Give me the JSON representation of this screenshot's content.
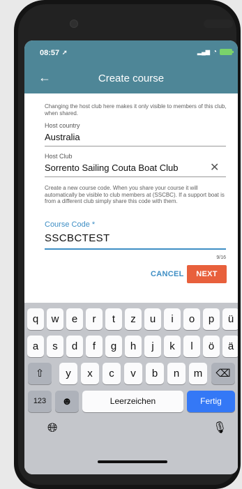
{
  "status": {
    "time": "08:57"
  },
  "appbar": {
    "title": "Create course"
  },
  "form": {
    "host_hint": "Changing the host club here makes it only visible to members of this club, when shared.",
    "host_country_label": "Host country",
    "host_country_value": "Australia",
    "host_club_label": "Host Club",
    "host_club_value": "Sorrento Sailing Couta Boat Club",
    "course_hint": "Create a new course code. When you share your course it will automatically be visible to club members at (SSCBC). If a support boat is from a different club simply share this code with them.",
    "course_code_label": "Course Code *",
    "course_code_value": "SSCBCTEST",
    "counter": "9/16",
    "cancel_label": "CANCEL",
    "next_label": "NEXT"
  },
  "keyboard": {
    "row1": [
      "q",
      "w",
      "e",
      "r",
      "t",
      "z",
      "u",
      "i",
      "o",
      "p",
      "ü"
    ],
    "row2": [
      "a",
      "s",
      "d",
      "f",
      "g",
      "h",
      "j",
      "k",
      "l",
      "ö",
      "ä"
    ],
    "row3": [
      "y",
      "x",
      "c",
      "v",
      "b",
      "n",
      "m"
    ],
    "numbers_label": "123",
    "space_label": "Leerzeichen",
    "done_label": "Fertig"
  },
  "icons": {
    "back": "arrow-left",
    "clear": "close",
    "shift": "shift-arrow",
    "backspace": "delete-left",
    "emoji": "smiley",
    "globe": "globe",
    "mic": "microphone"
  },
  "colors": {
    "accent": "#3e8ec4",
    "appbar": "#4e8697",
    "next_button": "#e8603c",
    "done_key": "#3478f6"
  }
}
